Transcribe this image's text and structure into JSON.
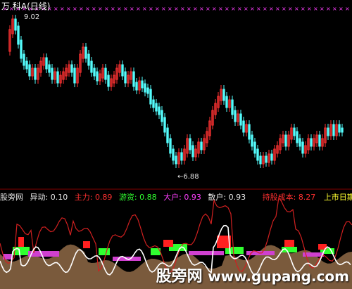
{
  "header": {
    "prefix": "万",
    "stock_name": "科A",
    "period": "(日线)"
  },
  "main_chart": {
    "high_label": "9.02",
    "low_label": "←6.88",
    "colors": {
      "up": "#ff3232",
      "down": "#54fcfc",
      "dots": "#ff40ff",
      "grid": "#800000"
    }
  },
  "info_bar": {
    "brand": "股旁网",
    "yidong_label": "异动:",
    "yidong_value": "0.10",
    "zhuli_label": "主力:",
    "zhuli_value": "0.89",
    "youzi_label": "游资:",
    "youzi_value": "0.88",
    "dahu_label": "大户:",
    "dahu_value": "0.93",
    "sanhu_label": "散户:",
    "sanhu_value": "0.93",
    "cost_label": "持股成本:",
    "cost_value": "8.27",
    "listing_label": "上市日期"
  },
  "watermark": {
    "logo": "股旁网",
    "url": "www.gupang.com"
  }
}
